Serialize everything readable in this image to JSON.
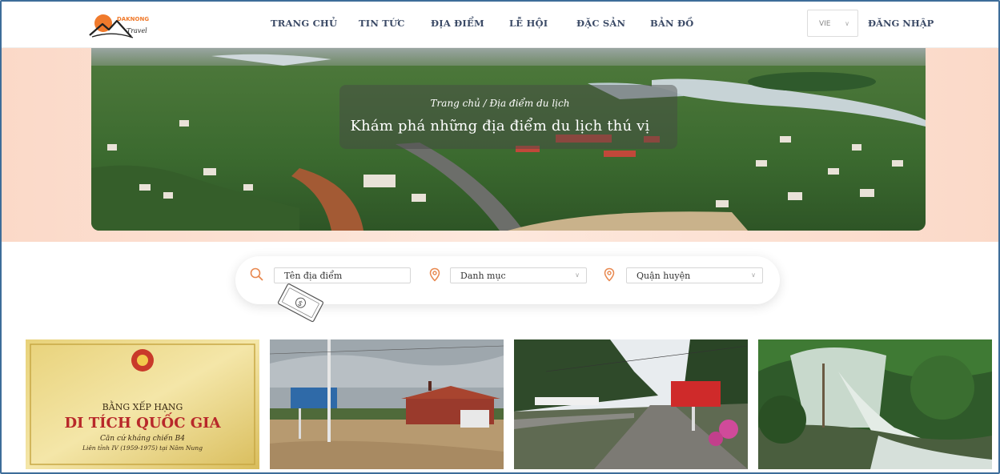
{
  "header": {
    "logo_text": "DAKNONG",
    "logo_script": "Travel",
    "nav": [
      {
        "label": "TRANG CHỦ"
      },
      {
        "label": "TIN TỨC"
      },
      {
        "label": "ĐỊA ĐIỂM"
      },
      {
        "label": "LỄ HỘI"
      },
      {
        "label": "ĐẶC SẢN"
      },
      {
        "label": "BẢN ĐỒ"
      }
    ],
    "language": "VIE",
    "login_label": "ĐĂNG NHẬP"
  },
  "hero": {
    "breadcrumb": "Trang chủ / Địa điểm du lịch",
    "title": "Khám phá những địa điểm du lịch thú vị"
  },
  "search": {
    "name_placeholder": "Tên địa điểm",
    "category_value": "Danh mục",
    "district_value": "Quận huyện"
  },
  "cards": [
    {
      "image": "certificate",
      "lines": [
        "BẰNG XẾP HẠNG",
        "DI TÍCH QUỐC GIA",
        "Căn cứ kháng chiến B4",
        "Liên tỉnh IV (1959-1975) tại Nâm Nung"
      ]
    },
    {
      "image": "historic-site-red-house"
    },
    {
      "image": "road-with-signboard"
    },
    {
      "image": "waterfall-forest"
    }
  ],
  "colors": {
    "nav_text": "#3b4a66",
    "accent": "#e8884f",
    "hero_band": "#fbd9c8",
    "frame": "#3d6d99"
  }
}
